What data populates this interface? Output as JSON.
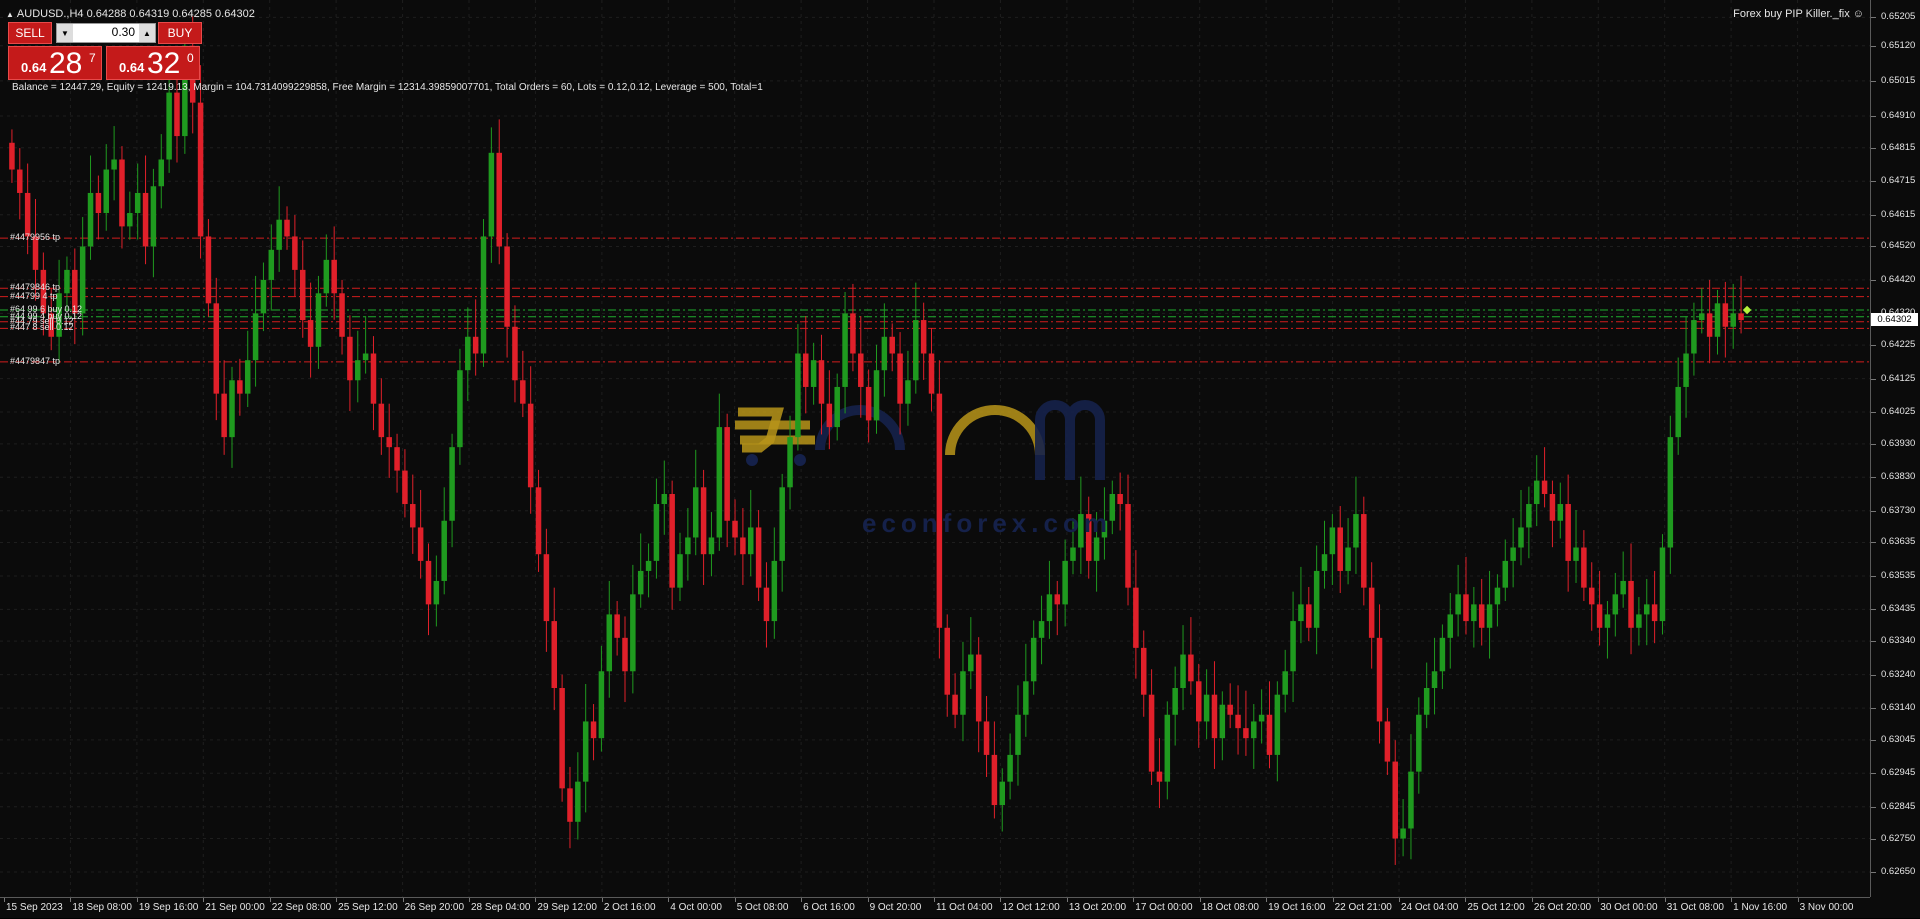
{
  "chart": {
    "title": "AUDUSD.,H4  0.64288 0.64319 0.64285 0.64302",
    "ea_name": "Forex  buy PIP Killer._fix",
    "ea_icon": "smiley-icon",
    "account_line": "Balance = 12447.29, Equity = 12419.13, Margin = 104.7314099229858, Free Margin = 12314.39859007701, Total Orders = 60, Lots = 0.12,0.12, Leverage = 500, Total=1",
    "current_price": "0.64302"
  },
  "one_click": {
    "sell_label": "SELL",
    "buy_label": "BUY",
    "lot_value": "0.30",
    "bid_prefix": "0.64",
    "bid_big": "28",
    "bid_sup": "7",
    "ask_prefix": "0.64",
    "ask_big": "32",
    "ask_sup": "0"
  },
  "order_labels": [
    {
      "text": "#4479956 tp",
      "price": 0.64545
    },
    {
      "text": "#4479846 tp",
      "price": 0.64395
    },
    {
      "text": "#44799 4 tp",
      "price": 0.6437
    },
    {
      "text": "#64  99 6 buy  0.12",
      "price": 0.6433
    },
    {
      "text": "#44  99 4 buy  0.12",
      "price": 0.6431
    },
    {
      "text": "#44  79 sell 0.12",
      "price": 0.64295
    },
    {
      "text": "#447  8 sell 0.12",
      "price": 0.64275
    },
    {
      "text": "#4479847 tp",
      "price": 0.64175
    }
  ],
  "y_axis": {
    "min": 0.6262,
    "max": 0.65215,
    "ticks": [
      "0.65205",
      "0.65120",
      "0.65015",
      "0.64910",
      "0.64815",
      "0.64715",
      "0.64615",
      "0.64520",
      "0.64420",
      "0.64320",
      "0.64225",
      "0.64125",
      "0.64025",
      "0.63930",
      "0.63830",
      "0.63730",
      "0.63635",
      "0.63535",
      "0.63435",
      "0.63340",
      "0.63240",
      "0.63140",
      "0.63045",
      "0.62945",
      "0.62845",
      "0.62750",
      "0.62650"
    ]
  },
  "x_axis": {
    "ticks": [
      "15 Sep 2023",
      "18 Sep 08:00",
      "19 Sep 16:00",
      "21 Sep 00:00",
      "22 Sep 08:00",
      "25 Sep 12:00",
      "26 Sep 20:00",
      "28 Sep 04:00",
      "29 Sep 12:00",
      "2 Oct 16:00",
      "4 Oct 00:00",
      "5 Oct 08:00",
      "6 Oct 16:00",
      "9 Oct 20:00",
      "11 Oct 04:00",
      "12 Oct 12:00",
      "13 Oct 20:00",
      "17 Oct 00:00",
      "18 Oct 08:00",
      "19 Oct 16:00",
      "22 Oct 21:00",
      "24 Oct 04:00",
      "25 Oct 12:00",
      "26 Oct 20:00",
      "30 Oct 00:00",
      "31 Oct 08:00",
      "1 Nov 16:00",
      "3 Nov 00:00"
    ]
  },
  "levels": [
    {
      "price": 0.64545,
      "color": "#d11c1c"
    },
    {
      "price": 0.64395,
      "color": "#d11c1c"
    },
    {
      "price": 0.6437,
      "color": "#d11c1c"
    },
    {
      "price": 0.6433,
      "color": "#1fae2e"
    },
    {
      "price": 0.6431,
      "color": "#1fae2e"
    },
    {
      "price": 0.64295,
      "color": "#d11c1c"
    },
    {
      "price": 0.64275,
      "color": "#d11c1c"
    },
    {
      "price": 0.64175,
      "color": "#d11c1c"
    }
  ],
  "colors": {
    "bull": "#1f9a1f",
    "bear": "#e0202a",
    "grid": "#1e1e1e",
    "watermark": "#b8951a",
    "watermark_text": "#15214a"
  },
  "watermark": {
    "text": "econforex.com"
  },
  "chart_data": {
    "type": "candlestick",
    "symbol": "AUDUSD.",
    "timeframe": "H4",
    "ylim": [
      0.6262,
      0.65215
    ],
    "closes": [
      0.6475,
      0.6468,
      0.6455,
      0.6445,
      0.6432,
      0.6425,
      0.6438,
      0.6445,
      0.6432,
      0.6452,
      0.6468,
      0.6462,
      0.6475,
      0.6478,
      0.6458,
      0.6462,
      0.6468,
      0.6452,
      0.647,
      0.6478,
      0.6498,
      0.6485,
      0.6512,
      0.6495,
      0.6455,
      0.6435,
      0.6408,
      0.6395,
      0.6412,
      0.6408,
      0.6418,
      0.6432,
      0.6442,
      0.6451,
      0.646,
      0.6455,
      0.6445,
      0.643,
      0.6422,
      0.6438,
      0.6448,
      0.6438,
      0.6425,
      0.6412,
      0.6418,
      0.642,
      0.6405,
      0.6395,
      0.6392,
      0.6385,
      0.6375,
      0.6368,
      0.6358,
      0.6345,
      0.6352,
      0.637,
      0.6392,
      0.6415,
      0.6425,
      0.642,
      0.6455,
      0.648,
      0.6452,
      0.6428,
      0.6412,
      0.6405,
      0.638,
      0.636,
      0.634,
      0.632,
      0.629,
      0.628,
      0.6292,
      0.631,
      0.6305,
      0.6325,
      0.6342,
      0.6335,
      0.6325,
      0.6348,
      0.6355,
      0.6358,
      0.6375,
      0.6378,
      0.635,
      0.636,
      0.6365,
      0.638,
      0.636,
      0.6365,
      0.6398,
      0.637,
      0.6365,
      0.636,
      0.6368,
      0.635,
      0.634,
      0.6358,
      0.638,
      0.6395,
      0.642,
      0.641,
      0.6418,
      0.6405,
      0.6398,
      0.641,
      0.6432,
      0.642,
      0.641,
      0.64,
      0.6415,
      0.6425,
      0.642,
      0.6405,
      0.6412,
      0.643,
      0.642,
      0.6408,
      0.6338,
      0.6318,
      0.6312,
      0.6325,
      0.633,
      0.631,
      0.63,
      0.6285,
      0.6292,
      0.63,
      0.6312,
      0.6322,
      0.6335,
      0.634,
      0.6348,
      0.6345,
      0.6358,
      0.6362,
      0.6372,
      0.6358,
      0.6365,
      0.637,
      0.6378,
      0.6375,
      0.635,
      0.6332,
      0.6318,
      0.6295,
      0.6292,
      0.6312,
      0.632,
      0.633,
      0.6322,
      0.631,
      0.6318,
      0.6305,
      0.6315,
      0.6312,
      0.6308,
      0.6305,
      0.631,
      0.6312,
      0.63,
      0.6318,
      0.6325,
      0.634,
      0.6345,
      0.6338,
      0.6355,
      0.636,
      0.6368,
      0.6355,
      0.6362,
      0.6372,
      0.635,
      0.6335,
      0.631,
      0.6298,
      0.6275,
      0.6278,
      0.6295,
      0.6312,
      0.632,
      0.6325,
      0.6335,
      0.6342,
      0.6348,
      0.634,
      0.6345,
      0.6338,
      0.6345,
      0.635,
      0.6358,
      0.6362,
      0.6368,
      0.6375,
      0.6382,
      0.6378,
      0.637,
      0.6375,
      0.6358,
      0.6362,
      0.635,
      0.6345,
      0.6338,
      0.6342,
      0.6348,
      0.6352,
      0.6338,
      0.6342,
      0.6345,
      0.634,
      0.6362,
      0.6395,
      0.641,
      0.642,
      0.643,
      0.6432,
      0.6425,
      0.6435,
      0.6428,
      0.6432,
      0.643
    ]
  }
}
